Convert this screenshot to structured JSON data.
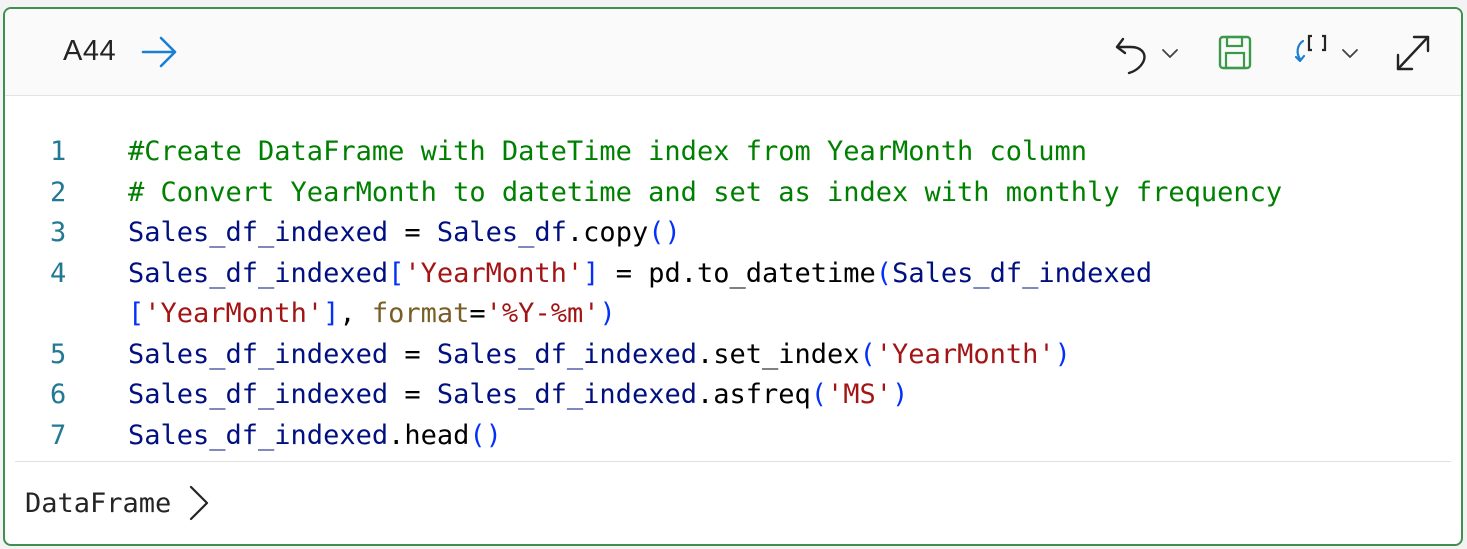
{
  "cell": {
    "id": "A44",
    "accent_color": "#3f8f4f"
  },
  "toolbar": {
    "items": [
      {
        "icon": "undo-icon",
        "has_dropdown": true
      },
      {
        "icon": "save-icon",
        "has_dropdown": false
      },
      {
        "icon": "cell-variables-icon",
        "has_dropdown": true
      },
      {
        "icon": "expand-icon",
        "has_dropdown": false
      }
    ]
  },
  "code": {
    "line_numbers": [
      "1",
      "2",
      "3",
      "4",
      "5",
      "6",
      "7"
    ],
    "lines": [
      [
        {
          "t": "comment",
          "v": "#Create DataFrame with DateTime index from YearMonth column"
        }
      ],
      [
        {
          "t": "comment",
          "v": "# Convert YearMonth to datetime and set as index with monthly frequency"
        }
      ],
      [
        {
          "t": "var",
          "v": "Sales_df_indexed"
        },
        {
          "t": "op",
          "v": " = "
        },
        {
          "t": "var",
          "v": "Sales_df"
        },
        {
          "t": "fn",
          "v": ".copy"
        },
        {
          "t": "paren",
          "v": "()"
        }
      ],
      [
        {
          "t": "var",
          "v": "Sales_df_indexed"
        },
        {
          "t": "paren",
          "v": "["
        },
        {
          "t": "str",
          "v": "'YearMonth'"
        },
        {
          "t": "paren",
          "v": "]"
        },
        {
          "t": "op",
          "v": " = "
        },
        {
          "t": "fn",
          "v": "pd.to_datetime"
        },
        {
          "t": "paren",
          "v": "("
        },
        {
          "t": "var",
          "v": "Sales_df_indexed"
        }
      ],
      [
        {
          "t": "paren",
          "v": "["
        },
        {
          "t": "str",
          "v": "'YearMonth'"
        },
        {
          "t": "paren",
          "v": "]"
        },
        {
          "t": "op",
          "v": ", "
        },
        {
          "t": "kw",
          "v": "format"
        },
        {
          "t": "op",
          "v": "="
        },
        {
          "t": "str",
          "v": "'%Y-%m'"
        },
        {
          "t": "paren",
          "v": ")"
        }
      ],
      [
        {
          "t": "var",
          "v": "Sales_df_indexed"
        },
        {
          "t": "op",
          "v": " = "
        },
        {
          "t": "var",
          "v": "Sales_df_indexed"
        },
        {
          "t": "fn",
          "v": ".set_index"
        },
        {
          "t": "paren",
          "v": "("
        },
        {
          "t": "str",
          "v": "'YearMonth'"
        },
        {
          "t": "paren",
          "v": ")"
        }
      ],
      [
        {
          "t": "var",
          "v": "Sales_df_indexed"
        },
        {
          "t": "op",
          "v": " = "
        },
        {
          "t": "var",
          "v": "Sales_df_indexed"
        },
        {
          "t": "fn",
          "v": ".asfreq"
        },
        {
          "t": "paren",
          "v": "("
        },
        {
          "t": "str",
          "v": "'MS'"
        },
        {
          "t": "paren",
          "v": ")"
        }
      ],
      [
        {
          "t": "var",
          "v": "Sales_df_indexed"
        },
        {
          "t": "fn",
          "v": ".head"
        },
        {
          "t": "paren",
          "v": "()"
        }
      ]
    ]
  },
  "output": {
    "label": "DataFrame",
    "icon": "chevron-right-icon"
  }
}
